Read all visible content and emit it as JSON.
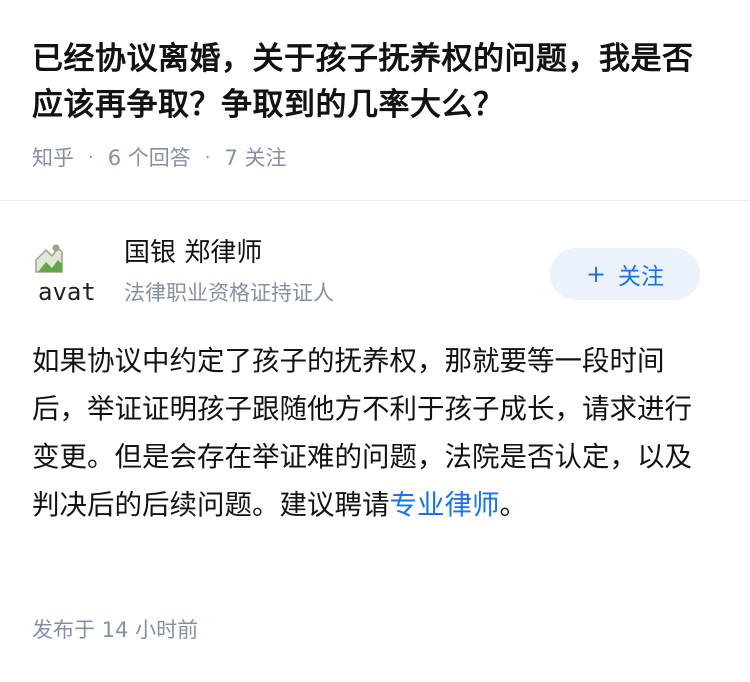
{
  "question": {
    "title": "已经协议离婚，关于孩子抚养权的问题，我是否应该再争取？争取到的几率大么？",
    "source": "知乎",
    "answers": "6 个回答",
    "followers": "7 关注"
  },
  "author": {
    "avatar_alt": "avatar",
    "name": "国银 郑律师",
    "badge": "法律职业资格证持证人",
    "follow_label": "关注",
    "follow_icon": "plus-icon"
  },
  "answer": {
    "text_before_link": "如果协议中约定了孩子的抚养权，那就要等一段时间后，举证证明孩子跟随他方不利于孩子成长，请求进行变更。但是会存在举证难的问题，法院是否认定，以及判决后的后续问题。建议聘请",
    "link_text": "专业律师",
    "text_after_link": "。"
  },
  "footer": {
    "published": "发布于  14 小时前"
  },
  "colors": {
    "title": "#121212",
    "meta": "#8590a6",
    "link": "#1772f6",
    "follow_bg": "#ebf2fb"
  }
}
